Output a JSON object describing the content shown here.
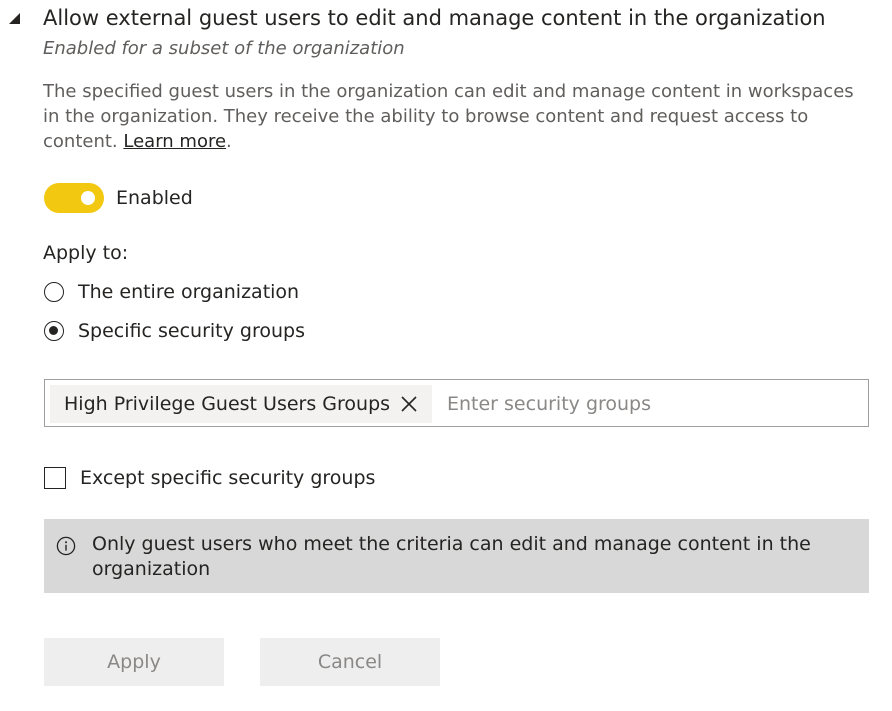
{
  "setting": {
    "title": "Allow external guest users to edit and manage content in the organization",
    "subtitle": "Enabled for a subset of the organization",
    "description": "The specified guest users in the organization can edit and manage content in workspaces in the organization. They receive the ability to browse content and request access to content.",
    "learn_more_label": "Learn more",
    "description_end": "."
  },
  "toggle": {
    "state": "on",
    "label": "Enabled",
    "accent_color": "#f2c811"
  },
  "apply_to": {
    "label": "Apply to:",
    "options": [
      {
        "label": "The entire organization",
        "selected": false
      },
      {
        "label": "Specific security groups",
        "selected": true
      }
    ]
  },
  "security_groups": {
    "chips": [
      {
        "label": "High Privilege Guest Users Groups"
      }
    ],
    "input_value": "",
    "placeholder": "Enter security groups"
  },
  "except": {
    "label": "Except specific security groups",
    "checked": false
  },
  "info": {
    "icon": "info-icon",
    "text": "Only guest users who meet the criteria can edit and manage content in the organization"
  },
  "buttons": {
    "apply_label": "Apply",
    "cancel_label": "Cancel"
  }
}
